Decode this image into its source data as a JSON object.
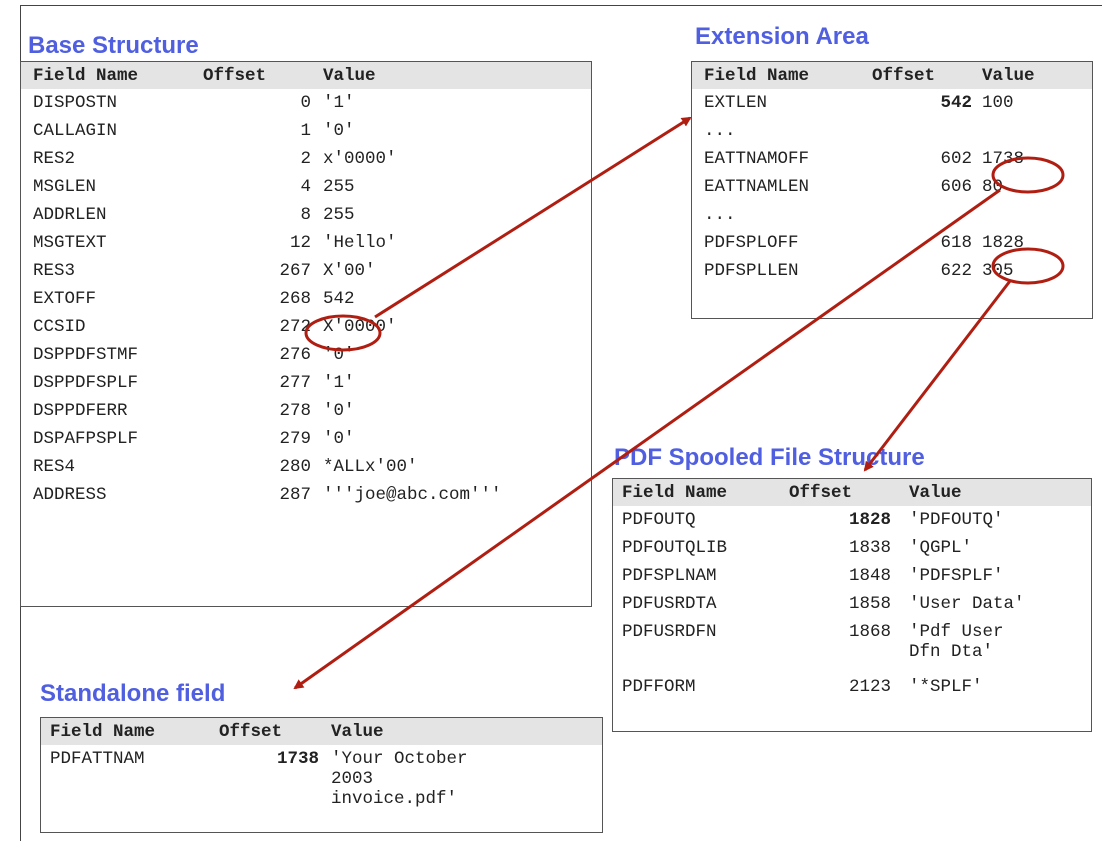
{
  "headings": {
    "base": "Base Structure",
    "extension": "Extension Area",
    "pdf_spooled": "PDF Spooled File Structure",
    "standalone": "Standalone field"
  },
  "columns": {
    "name": "Field Name",
    "offset": "Offset",
    "value": "Value"
  },
  "base_rows": [
    {
      "name": "DISPOSTN",
      "offset": "0",
      "value": "'1'"
    },
    {
      "name": "CALLAGIN",
      "offset": "1",
      "value": "'0'"
    },
    {
      "name": "RES2",
      "offset": "2",
      "value": "x'0000'"
    },
    {
      "name": "MSGLEN",
      "offset": "4",
      "value": "255"
    },
    {
      "name": "ADDRLEN",
      "offset": "8",
      "value": "255"
    },
    {
      "name": "MSGTEXT",
      "offset": "12",
      "value": "'Hello'"
    },
    {
      "name": "RES3",
      "offset": "267",
      "value": "X'00'"
    },
    {
      "name": "EXTOFF",
      "offset": "268",
      "value": "542"
    },
    {
      "name": "CCSID",
      "offset": "272",
      "value": "X'0000'"
    },
    {
      "name": "DSPPDFSTMF",
      "offset": "276",
      "value": "'0'"
    },
    {
      "name": "DSPPDFSPLF",
      "offset": "277",
      "value": "'1'"
    },
    {
      "name": "DSPPDFERR",
      "offset": "278",
      "value": "'0'"
    },
    {
      "name": "DSPAFPSPLF",
      "offset": "279",
      "value": "'0'"
    },
    {
      "name": "RES4",
      "offset": "280",
      "value": "*ALLx'00'"
    },
    {
      "name": "ADDRESS",
      "offset": "287",
      "value": "'''joe@abc.com'''"
    }
  ],
  "extension_rows": [
    {
      "name": "EXTLEN",
      "offset": "542",
      "value": "100"
    },
    {
      "name": "...",
      "offset": "",
      "value": ""
    },
    {
      "name": "EATTNAMOFF",
      "offset": "602",
      "value": "1738"
    },
    {
      "name": "EATTNAMLEN",
      "offset": "606",
      "value": "80"
    },
    {
      "name": "...",
      "offset": "",
      "value": ""
    },
    {
      "name": "PDFSPLOFF",
      "offset": "618",
      "value": "1828"
    },
    {
      "name": "PDFSPLLEN",
      "offset": "622",
      "value": "305"
    }
  ],
  "pdf_rows": [
    {
      "name": "PDFOUTQ",
      "offset": "1828",
      "value": "'PDFOUTQ'"
    },
    {
      "name": "PDFOUTQLIB",
      "offset": "1838",
      "value": "'QGPL'"
    },
    {
      "name": "PDFSPLNAM",
      "offset": "1848",
      "value": "'PDFSPLF'"
    },
    {
      "name": "PDFUSRDTA",
      "offset": "1858",
      "value": "'User Data'"
    },
    {
      "name": "PDFUSRDFN",
      "offset": "1868",
      "value": "'Pdf User\nDfn Dta'"
    },
    {
      "name": "PDFFORM",
      "offset": "2123",
      "value": "'*SPLF'"
    }
  ],
  "standalone_rows": [
    {
      "name": "PDFATTNAM",
      "offset": "1738",
      "value": "'Your October\n2003\ninvoice.pdf'"
    }
  ],
  "colors": {
    "heading": "#4f5fe0",
    "arrow": "#b01e12",
    "header_bg": "#e4e4e4"
  }
}
